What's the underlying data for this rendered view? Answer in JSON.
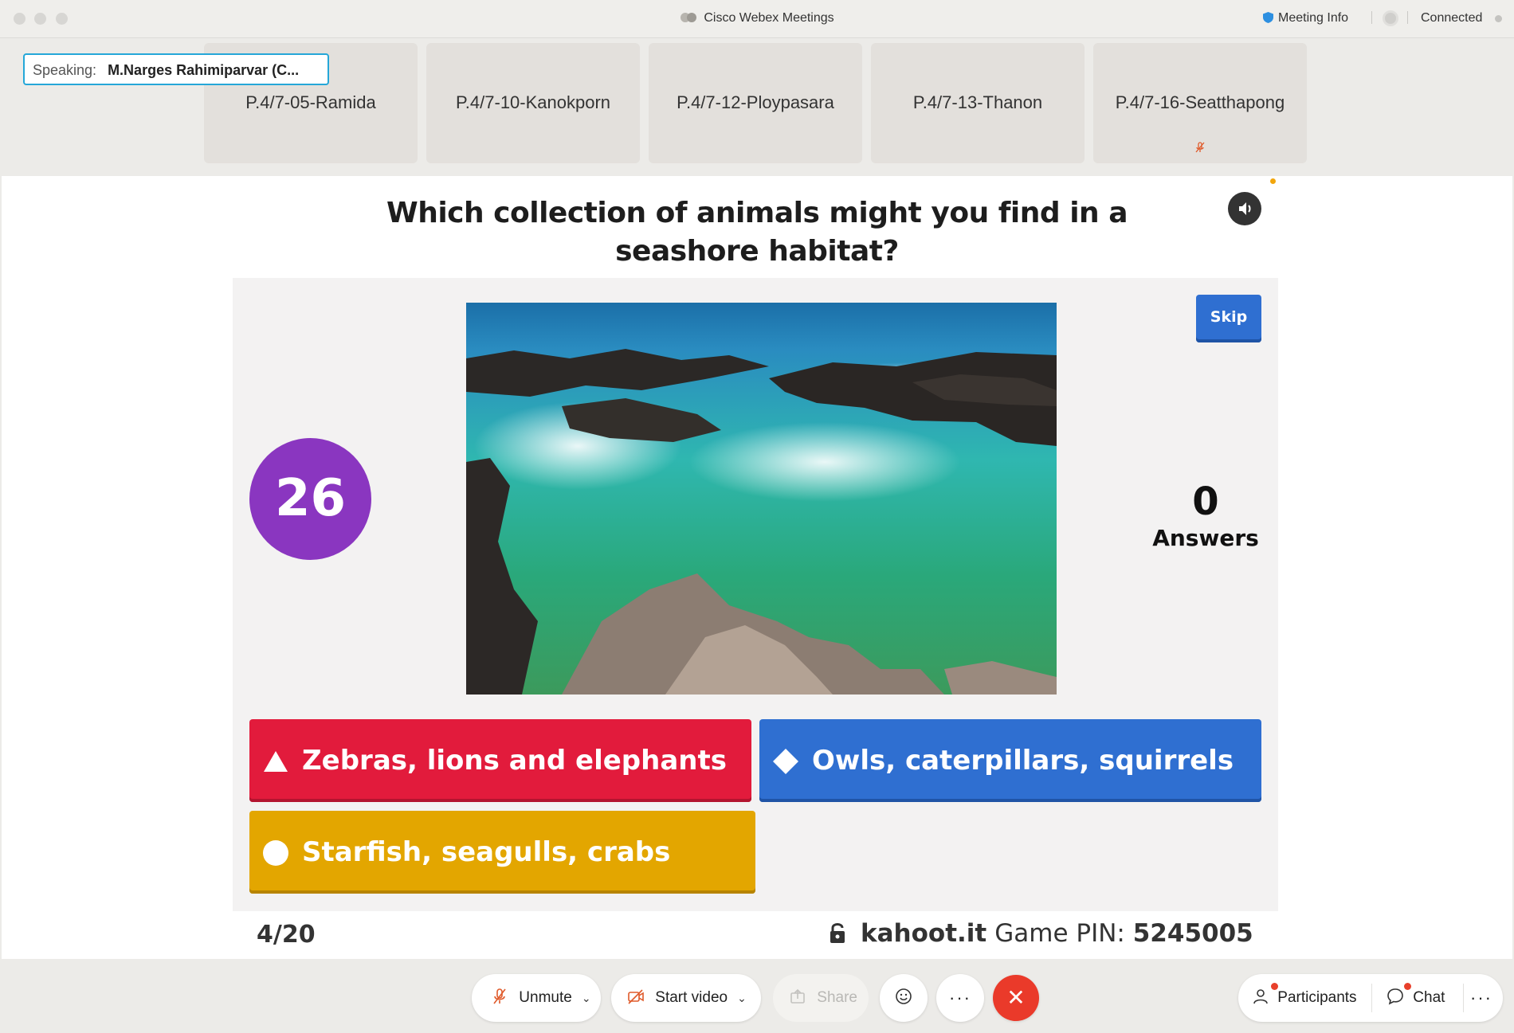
{
  "window": {
    "title": "Cisco Webex Meetings",
    "meeting_info": "Meeting Info",
    "status": "Connected"
  },
  "speaking": {
    "label": "Speaking:",
    "name": "M.Narges Rahimiparvar (C..."
  },
  "participants": [
    {
      "name": "P.4/7-05-Ramida",
      "muted": false
    },
    {
      "name": "P.4/7-10-Kanokporn",
      "muted": false
    },
    {
      "name": "P.4/7-12-Ploypasara",
      "muted": false
    },
    {
      "name": "P.4/7-13-Thanon",
      "muted": false
    },
    {
      "name": "P.4/7-16-Seatthapong",
      "muted": true
    }
  ],
  "quiz": {
    "question": "Which collection of animals might you find in a seashore habitat?",
    "timer": "26",
    "skip_label": "Skip",
    "answers_count": "0",
    "answers_label": "Answers",
    "options": [
      {
        "text": "Zebras, lions and elephants",
        "shape": "triangle",
        "color": "#e21b3c"
      },
      {
        "text": "Owls, caterpillars, squirrels",
        "shape": "diamond",
        "color": "#2f6fd1"
      },
      {
        "text": "Starfish, seagulls, crabs",
        "shape": "circle",
        "color": "#e3a600"
      }
    ],
    "progress": "4/20",
    "site": "kahoot.it",
    "pin_label": "Game PIN:",
    "pin": "5245005",
    "timer_color": "#8a36c0"
  },
  "toolbar": {
    "unmute": "Unmute",
    "start_video": "Start video",
    "share": "Share",
    "participants": "Participants",
    "chat": "Chat",
    "leave_color": "#ea3a2a"
  }
}
